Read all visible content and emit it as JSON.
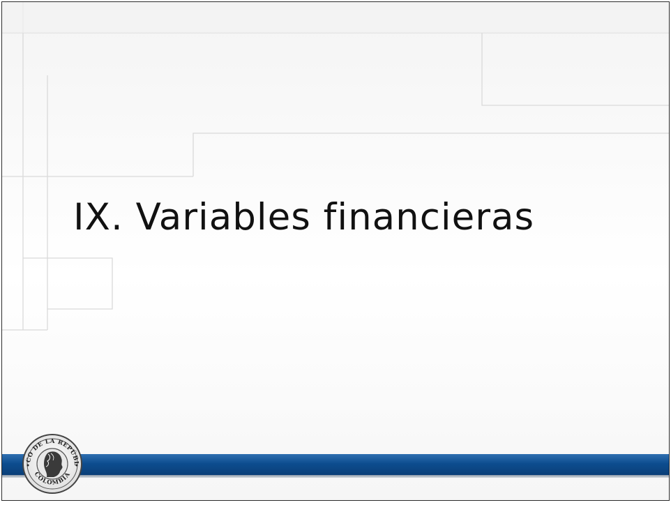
{
  "slide": {
    "title": "IX. Variables financieras"
  },
  "footer": {
    "band_color": "#0d4d8f",
    "logo": {
      "name": "banco-de-la-republica-seal",
      "ring_text_top": "BANCO DE LA REPÚBLICA",
      "ring_text_bottom": "COLOMBIA"
    }
  }
}
